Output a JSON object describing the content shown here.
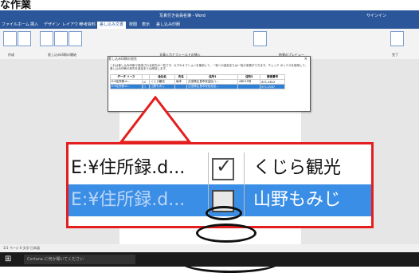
{
  "heading": "な作業",
  "window": {
    "title": "写真付き会員名簿 - Word",
    "user": "サインイン"
  },
  "tabs": [
    "ファイル",
    "ホーム",
    "挿入",
    "デザイン",
    "レイアウト",
    "参考資料",
    "差し込み文書",
    "校閲",
    "表示",
    "差し込み印刷"
  ],
  "ribbon": {
    "groups": [
      "作成",
      "差し込み印刷の開始",
      "文章入力とフィールドの挿入",
      "結果のプレビュー",
      "完了"
    ],
    "buttons": [
      "封筒",
      "ラベル",
      "差し込み印刷の開始",
      "宛先の選択",
      "アドレス帳の編集",
      "結果のプレビュー",
      "完了と差し込み"
    ]
  },
  "dialog": {
    "title": "差し込み印刷の宛先",
    "close": "×",
    "description": "これは差し込み印刷で使用される宛先の一覧です。以下のオプションを使用して、一覧への追加または一覧の変更ができます。チェック ボックスを使用して、差し込み印刷の宛先を追加または削除します。",
    "headers": [
      "データ ソース",
      "",
      "会社名",
      "氏名",
      "住所1",
      "住所2",
      "郵便番号"
    ],
    "rows": [
      {
        "source": "E:¥住所録.d...",
        "checked": true,
        "company": "くじら観光",
        "name": "坂本",
        "addr1": "広島県広島市安芸区八...",
        "addr2": "ABC15号",
        "zip": "671-1613"
      },
      {
        "source": "E:¥住所録.d...",
        "checked": false,
        "company": "山野もみじ",
        "name": "",
        "addr1": "広島県広島市安佐北区...",
        "addr2": "",
        "zip": "671-0087"
      }
    ]
  },
  "zoom": {
    "row1": {
      "file": "E:¥住所録.d...",
      "check": "✓",
      "name": "くじら観光"
    },
    "row2": {
      "file": "E:¥住所録.d...",
      "check": "",
      "name": "山野もみじ"
    }
  },
  "statusbar": {
    "left": "1/1 ページ  0 文字  日本語"
  },
  "taskbar": {
    "search": "Cortana に何か聞いてください"
  }
}
